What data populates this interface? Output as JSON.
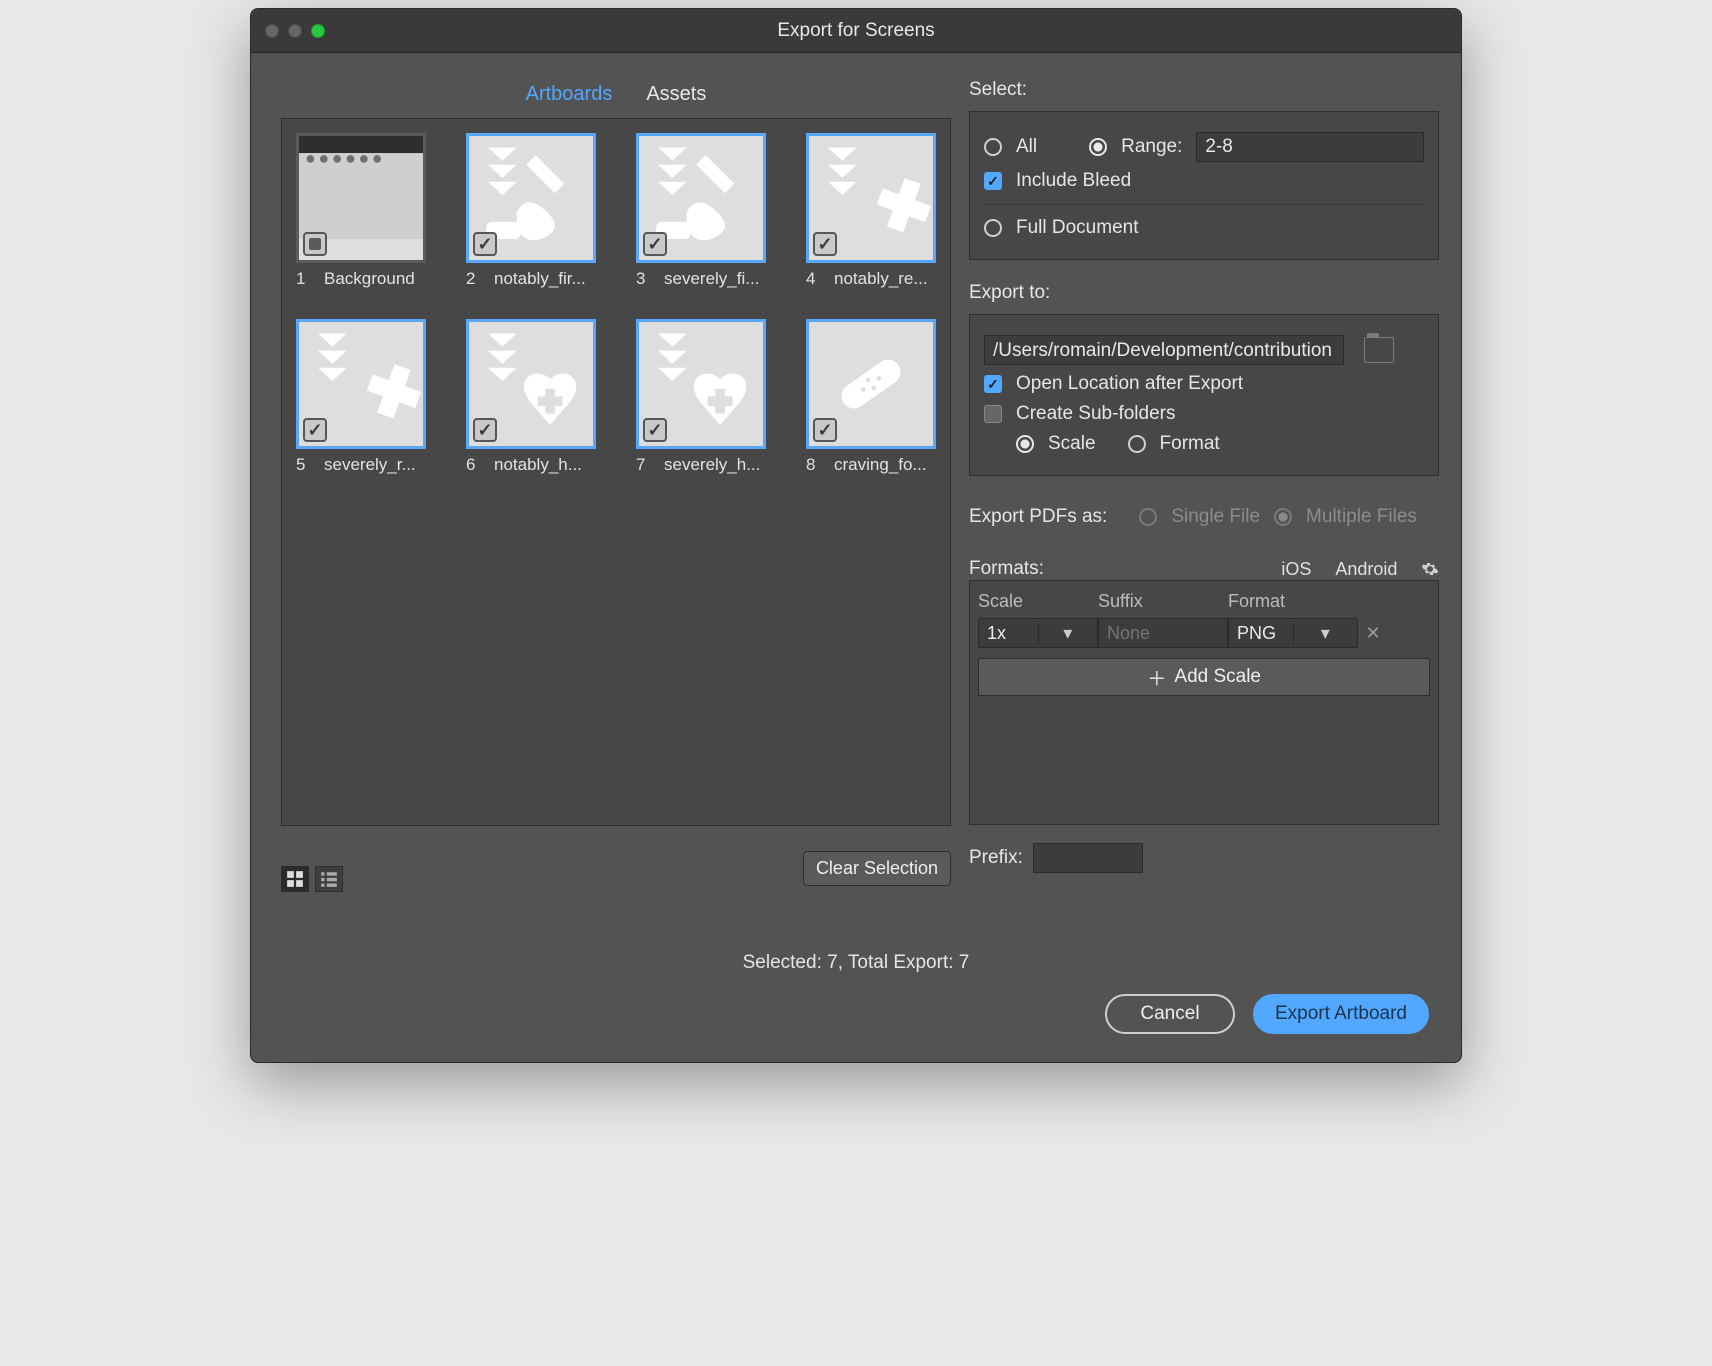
{
  "window": {
    "title": "Export for Screens"
  },
  "tabs": {
    "artboards": "Artboards",
    "assets": "Assets",
    "active": "artboards"
  },
  "artboards": [
    {
      "num": "1",
      "name": "Background",
      "selected": false
    },
    {
      "num": "2",
      "name": "notably_fir...",
      "selected": true
    },
    {
      "num": "3",
      "name": "severely_fi...",
      "selected": true
    },
    {
      "num": "4",
      "name": "notably_re...",
      "selected": true
    },
    {
      "num": "5",
      "name": "severely_r...",
      "selected": true
    },
    {
      "num": "6",
      "name": "notably_h...",
      "selected": true
    },
    {
      "num": "7",
      "name": "severely_h...",
      "selected": true
    },
    {
      "num": "8",
      "name": "craving_fo...",
      "selected": true
    }
  ],
  "select": {
    "label": "Select:",
    "all_label": "All",
    "range_label": "Range:",
    "range_value": "2-8",
    "include_bleed_label": "Include Bleed",
    "include_bleed_checked": true,
    "full_document_label": "Full Document",
    "mode": "range"
  },
  "export_to": {
    "label": "Export to:",
    "path": "/Users/romain/Development/contribution",
    "open_after_label": "Open Location after Export",
    "open_after_checked": true,
    "create_subfolders_label": "Create Sub-folders",
    "create_subfolders_checked": false,
    "scale_label": "Scale",
    "format_label": "Format",
    "subfolder_mode": "scale"
  },
  "export_pdfs": {
    "label": "Export PDFs as:",
    "single_label": "Single File",
    "multiple_label": "Multiple Files",
    "mode": "multiple",
    "enabled": false
  },
  "formats": {
    "label": "Formats:",
    "ios": "iOS",
    "android": "Android",
    "columns": {
      "scale": "Scale",
      "suffix": "Suffix",
      "format": "Format"
    },
    "rows": [
      {
        "scale": "1x",
        "suffix_placeholder": "None",
        "format": "PNG"
      }
    ],
    "add_scale_label": "Add Scale"
  },
  "footer": {
    "clear_selection": "Clear Selection",
    "prefix_label": "Prefix:",
    "prefix_value": "",
    "status": "Selected: 7, Total Export: 7",
    "cancel": "Cancel",
    "export": "Export Artboard"
  }
}
